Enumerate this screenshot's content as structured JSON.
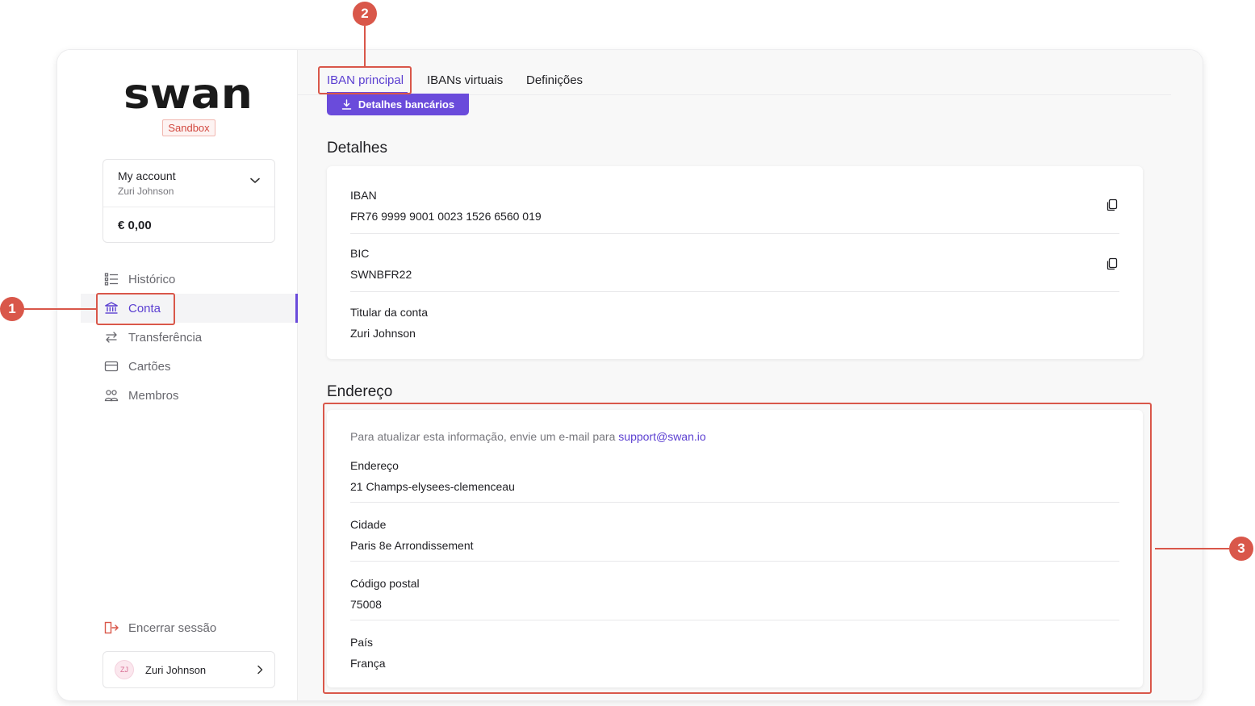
{
  "brand": {
    "logo_text": "swan",
    "environment": "Sandbox"
  },
  "account": {
    "name": "My account",
    "holder": "Zuri Johnson",
    "balance": "€ 0,00"
  },
  "nav": {
    "items": [
      {
        "label": "Histórico",
        "icon": "list-icon",
        "active": false
      },
      {
        "label": "Conta",
        "icon": "bank-icon",
        "active": true
      },
      {
        "label": "Transferência",
        "icon": "transfer-arrows-icon",
        "active": false
      },
      {
        "label": "Cartões",
        "icon": "card-icon",
        "active": false
      },
      {
        "label": "Membros",
        "icon": "members-icon",
        "active": false
      }
    ],
    "logout_label": "Encerrar sessão"
  },
  "user": {
    "initials": "ZJ",
    "name": "Zuri Johnson"
  },
  "tabs": [
    {
      "label": "IBAN principal",
      "active": true
    },
    {
      "label": "IBANs virtuais",
      "active": false
    },
    {
      "label": "Definições",
      "active": false
    }
  ],
  "bank_details_button": "Detalhes bancários",
  "details": {
    "title": "Detalhes",
    "fields": [
      {
        "label": "IBAN",
        "value": "FR76 9999 9001 0023 1526 6560 019",
        "copyable": true
      },
      {
        "label": "BIC",
        "value": "SWNBFR22",
        "copyable": true
      },
      {
        "label": "Titular da conta",
        "value": "Zuri Johnson",
        "copyable": false
      }
    ]
  },
  "address": {
    "title": "Endereço",
    "notice_text": "Para atualizar esta informação, envie um e-mail para ",
    "notice_email": "support@swan.io",
    "fields": [
      {
        "label": "Endereço",
        "value": "21 Champs-elysees-clemenceau"
      },
      {
        "label": "Cidade",
        "value": "Paris 8e Arrondissement"
      },
      {
        "label": "Código postal",
        "value": "75008"
      },
      {
        "label": "País",
        "value": "França"
      }
    ]
  },
  "annotations": [
    "1",
    "2",
    "3"
  ],
  "colors": {
    "accent": "#6a4bdb",
    "annotation": "#d9574a",
    "sandbox": "#d2483f"
  }
}
